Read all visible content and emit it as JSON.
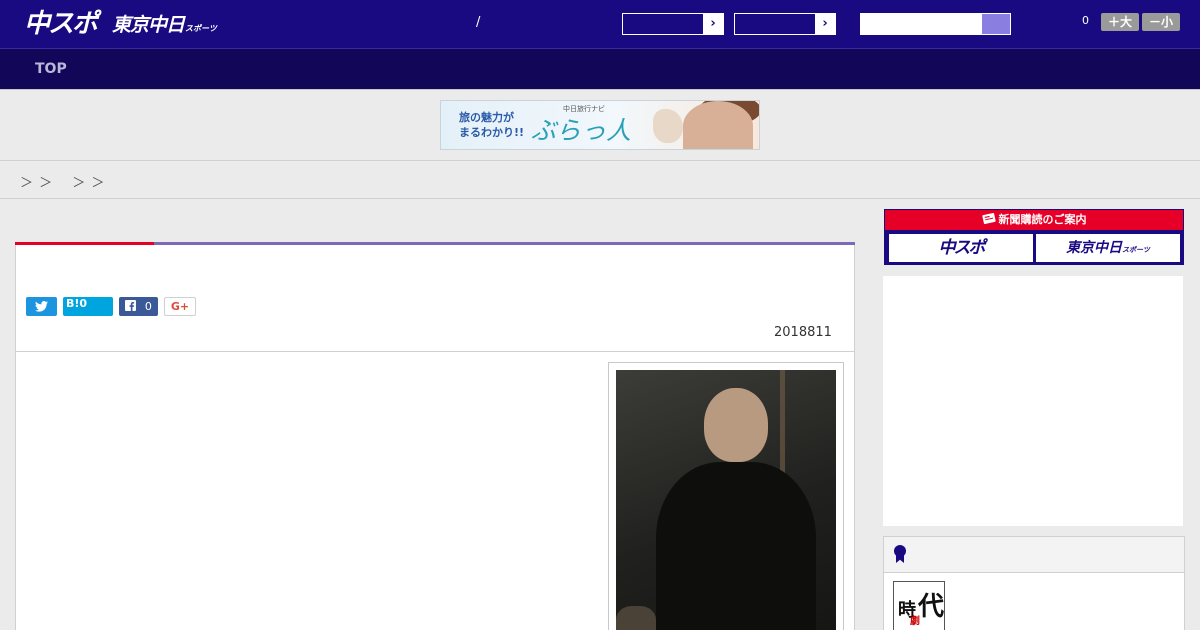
{
  "header": {
    "logo_main": "中スポ",
    "logo_tokyo": "東京中日",
    "logo_tokyo_sub": "スポーツ",
    "divider": "/",
    "select1_arrow": "›",
    "select2_arrow": "›",
    "search": {
      "placeholder": ""
    },
    "count": "0",
    "font_larger": "＋大",
    "font_smaller": "－小"
  },
  "nav": {
    "items": [
      {
        "label": "TOP"
      }
    ]
  },
  "banner": {
    "text_left": "旅の魅力が\nまるわかり!!",
    "text_small": "中日旅行ナビ",
    "text_brand": "ぶらっ人"
  },
  "breadcrumb": {
    "text": "＞ ＞　 ＞ ＞"
  },
  "article": {
    "share": {
      "twitter_icon": "twitter-icon",
      "hatena": "B!0",
      "facebook_count": "0",
      "gplus": "G+"
    },
    "date": "2018811"
  },
  "sidebar": {
    "subscribe": {
      "title": "新聞購読のご案内",
      "chuspo": "中スポ",
      "tokyo": "東京中日",
      "tokyo_sub": "スポーツ"
    },
    "ranking": {
      "icon": "medal-icon",
      "thumb_k1": "時",
      "thumb_k2": "代",
      "thumb_k3": "劇"
    }
  },
  "colors": {
    "header_bg": "#1a0a82",
    "nav_bg": "#110658",
    "accent_red": "#e60027",
    "accent_purple": "#7a6ab8"
  }
}
